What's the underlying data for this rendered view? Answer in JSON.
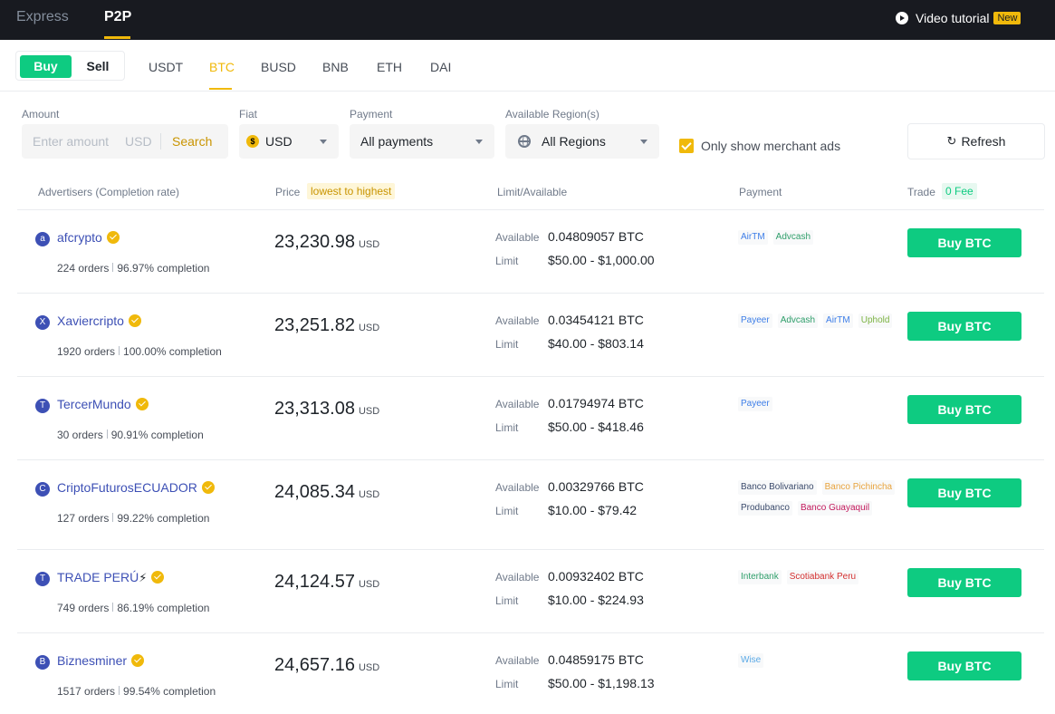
{
  "topbar": {
    "express": "Express",
    "p2p": "P2P",
    "video_tutorial": "Video tutorial",
    "new_badge": "New"
  },
  "trade_toggle": {
    "buy": "Buy",
    "sell": "Sell"
  },
  "assets": [
    "USDT",
    "BTC",
    "BUSD",
    "BNB",
    "ETH",
    "DAI"
  ],
  "active_asset": "BTC",
  "filters": {
    "amount_label": "Amount",
    "amount_placeholder": "Enter amount",
    "amount_currency": "USD",
    "search_label": "Search",
    "fiat_label": "Fiat",
    "fiat_value": "USD",
    "fiat_icon": "$",
    "payment_label": "Payment",
    "payment_value": "All payments",
    "region_label": "Available Region(s)",
    "region_value": "All Regions",
    "merchant_only_label": "Only show merchant ads",
    "merchant_only_checked": true,
    "refresh_label": "Refresh"
  },
  "table_header": {
    "advertisers": "Advertisers (Completion rate)",
    "price": "Price",
    "price_sort": "lowest to highest",
    "limit": "Limit/Available",
    "payment": "Payment",
    "trade": "Trade",
    "fee": "0 Fee"
  },
  "labels": {
    "available": "Available",
    "limit": "Limit",
    "price_unit": "USD",
    "buy_button": "Buy BTC"
  },
  "ads": [
    {
      "initial": "a",
      "name": "afcrypto",
      "orders": "224 orders",
      "completion": "96.97% completion",
      "price": "23,230.98",
      "available": "0.04809057 BTC",
      "limit": "$50.00 - $1,000.00",
      "payments": [
        {
          "name": "AirTM",
          "color": "#3d7ee8"
        },
        {
          "name": "Advcash",
          "color": "#2e9e6a"
        }
      ]
    },
    {
      "initial": "X",
      "name": "Xaviercripto",
      "orders": "1920 orders",
      "completion": "100.00% completion",
      "price": "23,251.82",
      "available": "0.03454121 BTC",
      "limit": "$40.00 - $803.14",
      "payments": [
        {
          "name": "Payeer",
          "color": "#3d7ee8"
        },
        {
          "name": "Advcash",
          "color": "#2e9e6a"
        },
        {
          "name": "AirTM",
          "color": "#3d7ee8"
        },
        {
          "name": "Uphold",
          "color": "#7cb342"
        }
      ]
    },
    {
      "initial": "T",
      "name": "TercerMundo",
      "orders": "30 orders",
      "completion": "90.91% completion",
      "price": "23,313.08",
      "available": "0.01794974 BTC",
      "limit": "$50.00 - $418.46",
      "payments": [
        {
          "name": "Payeer",
          "color": "#3d7ee8"
        }
      ]
    },
    {
      "initial": "C",
      "name": "CriptoFuturosECUADOR",
      "orders": "127 orders",
      "completion": "99.22% completion",
      "price": "24,085.34",
      "available": "0.00329766 BTC",
      "limit": "$10.00 - $79.42",
      "payments": [
        {
          "name": "Banco Bolivariano",
          "color": "#3a4a6b"
        },
        {
          "name": "Banco Pichincha",
          "color": "#e8a33d"
        },
        {
          "name": "Produbanco",
          "color": "#3a4a6b"
        },
        {
          "name": "Banco Guayaquil",
          "color": "#c2185b"
        }
      ]
    },
    {
      "initial": "T",
      "name": "TRADE PERÚ",
      "bolt": "⚡",
      "orders": "749 orders",
      "completion": "86.19% completion",
      "price": "24,124.57",
      "available": "0.00932402 BTC",
      "limit": "$10.00 - $224.93",
      "payments": [
        {
          "name": "Interbank",
          "color": "#2e9e6a"
        },
        {
          "name": "Scotiabank Peru",
          "color": "#d32f2f"
        }
      ]
    },
    {
      "initial": "B",
      "name": "Biznesminer",
      "orders": "1517 orders",
      "completion": "99.54% completion",
      "price": "24,657.16",
      "available": "0.04859175 BTC",
      "limit": "$50.00 - $1,198.13",
      "payments": [
        {
          "name": "Wise",
          "color": "#5aa9e6"
        }
      ]
    }
  ]
}
